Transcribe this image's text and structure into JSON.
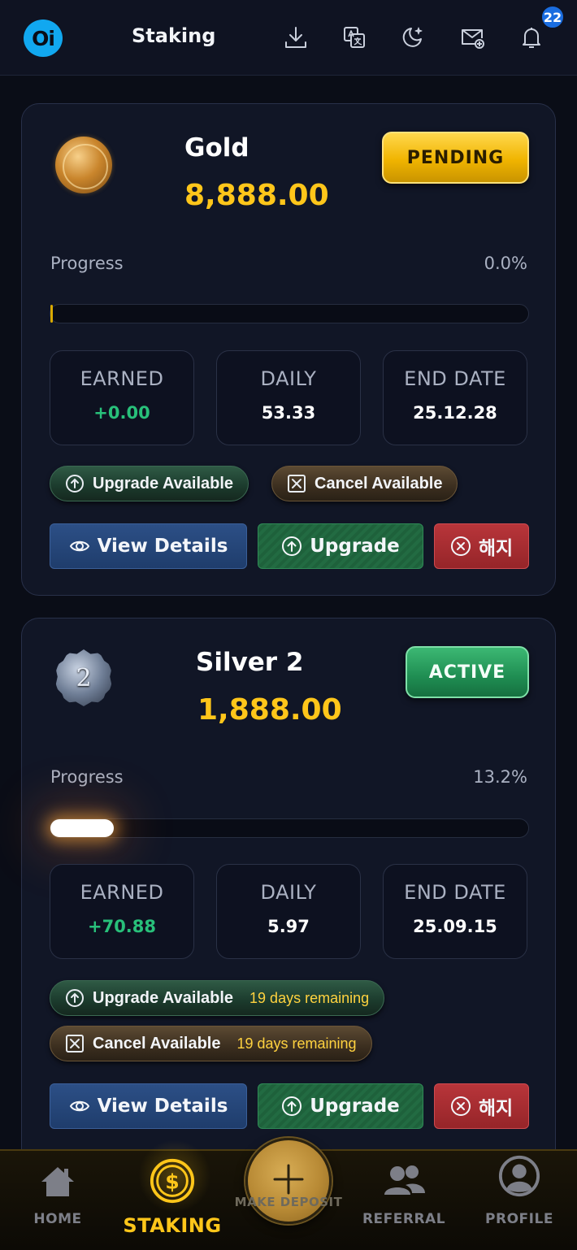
{
  "header": {
    "logo_text": "Oi",
    "title": "Staking",
    "notification_count": "22",
    "icons": [
      "download-icon",
      "translate-icon",
      "dark-mode-icon",
      "mail-add-icon",
      "bell-icon"
    ]
  },
  "stakes": [
    {
      "name": "Gold",
      "amount": "8,888.00",
      "status": "PENDING",
      "medal_icon": "gold-medal-icon",
      "progress_label": "Progress",
      "progress_text": "0.0%",
      "progress": 0.0,
      "earned_label": "EARNED",
      "earned": "+0.00",
      "daily_label": "DAILY",
      "daily": "53.33",
      "end_date_label": "END DATE",
      "end_date": "25.12.28",
      "upgrade_pill": "Upgrade Available",
      "cancel_pill": "Cancel Available",
      "view_details": "View Details",
      "upgrade": "Upgrade",
      "terminate": "해지"
    },
    {
      "name": "Silver 2",
      "amount": "1,888.00",
      "status": "ACTIVE",
      "medal_icon": "silver-medal-icon",
      "medal_number": "2",
      "progress_label": "Progress",
      "progress_text": "13.2%",
      "progress": 0.132,
      "earned_label": "EARNED",
      "earned": "+70.88",
      "daily_label": "DAILY",
      "daily": "5.97",
      "end_date_label": "END DATE",
      "end_date": "25.09.15",
      "upgrade_pill": "Upgrade Available",
      "upgrade_remaining": "19 days remaining",
      "cancel_pill": "Cancel Available",
      "cancel_remaining": "19 days remaining",
      "view_details": "View Details",
      "upgrade": "Upgrade",
      "terminate": "해지"
    }
  ],
  "nav": {
    "home": "HOME",
    "staking": "STAKING",
    "deposit": "MAKE DEPOSIT",
    "referral": "REFERRAL",
    "profile": "PROFILE",
    "active": "staking"
  },
  "colors": {
    "accent_gold": "#ffc61a",
    "earned_green": "#28c07a",
    "pending_bg": "#f0b400",
    "active_bg": "#1f8d52",
    "logo_blue": "#11a8f0",
    "badge_blue": "#1a6de0"
  }
}
